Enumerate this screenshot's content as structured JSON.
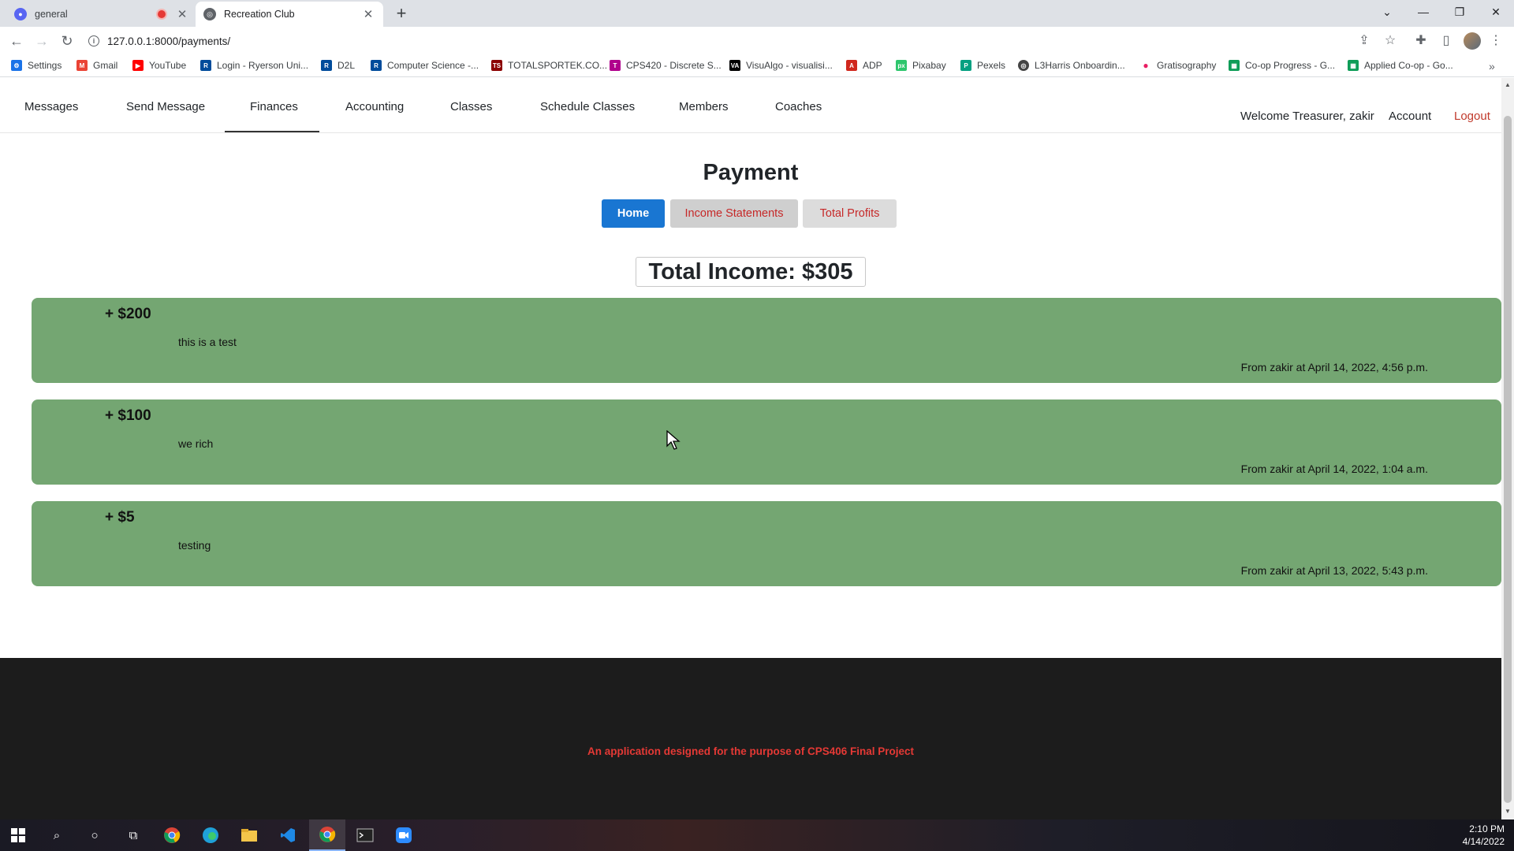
{
  "browser": {
    "tabs": [
      {
        "title": "general",
        "state": "inactive"
      },
      {
        "title": "Recreation Club",
        "state": "active"
      }
    ],
    "new_tab": "+",
    "url": "127.0.0.1:8000/payments/",
    "bookmarks": [
      {
        "label": "Settings",
        "icon": "gear-icon",
        "color": "#1a73e8"
      },
      {
        "label": "Gmail",
        "icon": "gmail-icon",
        "color": "#ea4335"
      },
      {
        "label": "YouTube",
        "icon": "youtube-icon",
        "color": "#ff0000"
      },
      {
        "label": "Login - Ryerson Uni...",
        "icon": "ryerson-icon",
        "color": "#004c9b"
      },
      {
        "label": "D2L",
        "icon": "d2l-icon",
        "color": "#004c9b"
      },
      {
        "label": "Computer Science -...",
        "icon": "ryerson-icon",
        "color": "#004c9b"
      },
      {
        "label": "TOTALSPORTEK.CO...",
        "icon": "ts-icon",
        "color": "#8b0000"
      },
      {
        "label": "CPS420 - Discrete S...",
        "icon": "t-icon",
        "color": "#b0008c"
      },
      {
        "label": "VisuAlgo - visualisi...",
        "icon": "visualgo-icon",
        "color": "#000000"
      },
      {
        "label": "ADP",
        "icon": "adp-icon",
        "color": "#d0271d"
      },
      {
        "label": "Pixabay",
        "icon": "pixabay-icon",
        "color": "#2ec66d"
      },
      {
        "label": "Pexels",
        "icon": "pexels-icon",
        "color": "#05a081"
      },
      {
        "label": "L3Harris Onboardin...",
        "icon": "globe-icon",
        "color": "#444444"
      },
      {
        "label": "Gratisography",
        "icon": "dot-icon",
        "color": "#e91e63"
      },
      {
        "label": "Co-op Progress - G...",
        "icon": "sheets-icon",
        "color": "#0f9d58"
      },
      {
        "label": "Applied Co-op - Go...",
        "icon": "sheets-icon",
        "color": "#0f9d58"
      }
    ]
  },
  "nav": {
    "items": [
      "Messages",
      "Send Message",
      "Finances",
      "Accounting",
      "Classes",
      "Schedule Classes",
      "Members",
      "Coaches"
    ],
    "active": "Finances",
    "welcome": "Welcome Treasurer, zakir",
    "account": "Account",
    "logout": "Logout"
  },
  "page": {
    "title": "Payment",
    "buttons": {
      "home": "Home",
      "income": "Income Statements",
      "profits": "Total Profits"
    },
    "total_income": "Total Income: $305"
  },
  "payments": [
    {
      "amount": "+ $200",
      "description": "this is a test",
      "meta": "From zakir at April 14, 2022, 4:56 p.m."
    },
    {
      "amount": "+ $100",
      "description": "we rich",
      "meta": "From zakir at April 14, 2022, 1:04 a.m."
    },
    {
      "amount": "+ $5",
      "description": "testing",
      "meta": "From zakir at April 13, 2022, 5:43 p.m."
    }
  ],
  "footer": {
    "text": "An application designed for the purpose of CPS406 Final Project"
  },
  "taskbar": {
    "time": "2:10 PM",
    "date": "4/14/2022"
  },
  "colors": {
    "accent": "#1976d2",
    "payment_bg": "#74a672",
    "logout": "#c0392b",
    "footer_text": "#e53935"
  }
}
